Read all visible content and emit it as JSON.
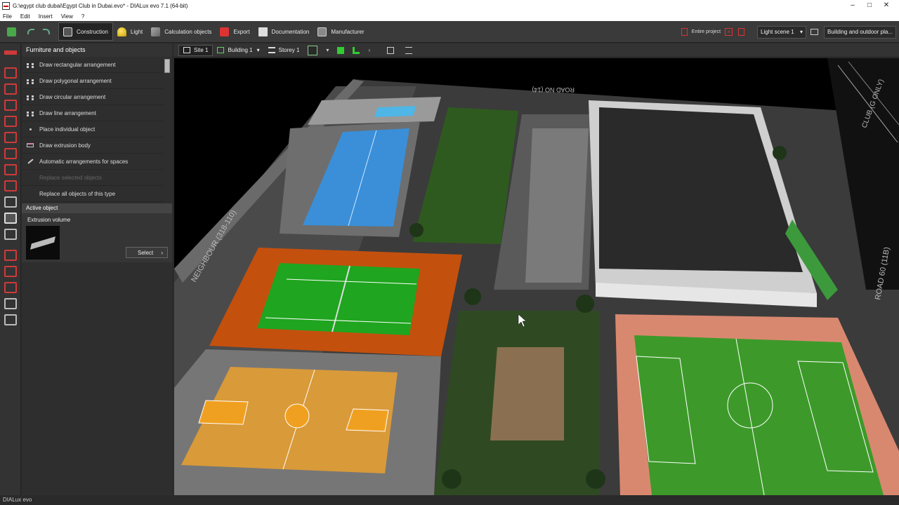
{
  "window": {
    "title": "G:\\egypt club dubai\\Egypt Club in Dubai.evo* - DIALux evo 7.1  (64-bit)",
    "controls": [
      "–",
      "□",
      "✕"
    ]
  },
  "menu": {
    "items": [
      "File",
      "Edit",
      "Insert",
      "View",
      "?"
    ]
  },
  "toolbar": {
    "construction": "Construction",
    "light": "Light",
    "calc_objects": "Calculation objects",
    "export": "Export",
    "documentation": "Documentation",
    "manufacturer": "Manufacturer",
    "entire_project": "Entire project",
    "light_scene": "Light scene 1",
    "view": "Building and outdoor pla..."
  },
  "panel": {
    "title": "Furniture and objects",
    "items": [
      {
        "label": "Draw rectangular arrangement",
        "enabled": true
      },
      {
        "label": "Draw polygonal arrangement",
        "enabled": true
      },
      {
        "label": "Draw circular arrangement",
        "enabled": true
      },
      {
        "label": "Draw line arrangement",
        "enabled": true
      },
      {
        "label": "Place individual object",
        "enabled": true
      },
      {
        "label": "Draw extrusion body",
        "enabled": true
      },
      {
        "label": "Automatic arrangements for spaces",
        "enabled": true
      },
      {
        "label": "Replace selected objects",
        "enabled": false
      },
      {
        "label": "Replace all objects of this type",
        "enabled": true
      }
    ],
    "active_object_header": "Active object",
    "active_object_label": "Extrusion volume",
    "select_button": "Select"
  },
  "viewbar": {
    "site": "Site 1",
    "building": "Building 1",
    "storey": "Storey 1"
  },
  "scene": {
    "road_top": "ROAD NO (14)",
    "neighbour": "NEIGHBOUR (318-110)",
    "road_right": "ROAD 60 (11B)",
    "club_label": "CLUB (G ONLY)"
  },
  "status": {
    "text": "DIALux evo"
  },
  "colors": {
    "accent_red": "#cf3a3a",
    "tennis_green": "#1fa51f",
    "tennis_orange": "#c4500e",
    "basket_orange": "#d99a3a",
    "pool_blue": "#3a8fd8",
    "football_green": "#3d9a2a",
    "track_pink": "#d98870"
  }
}
